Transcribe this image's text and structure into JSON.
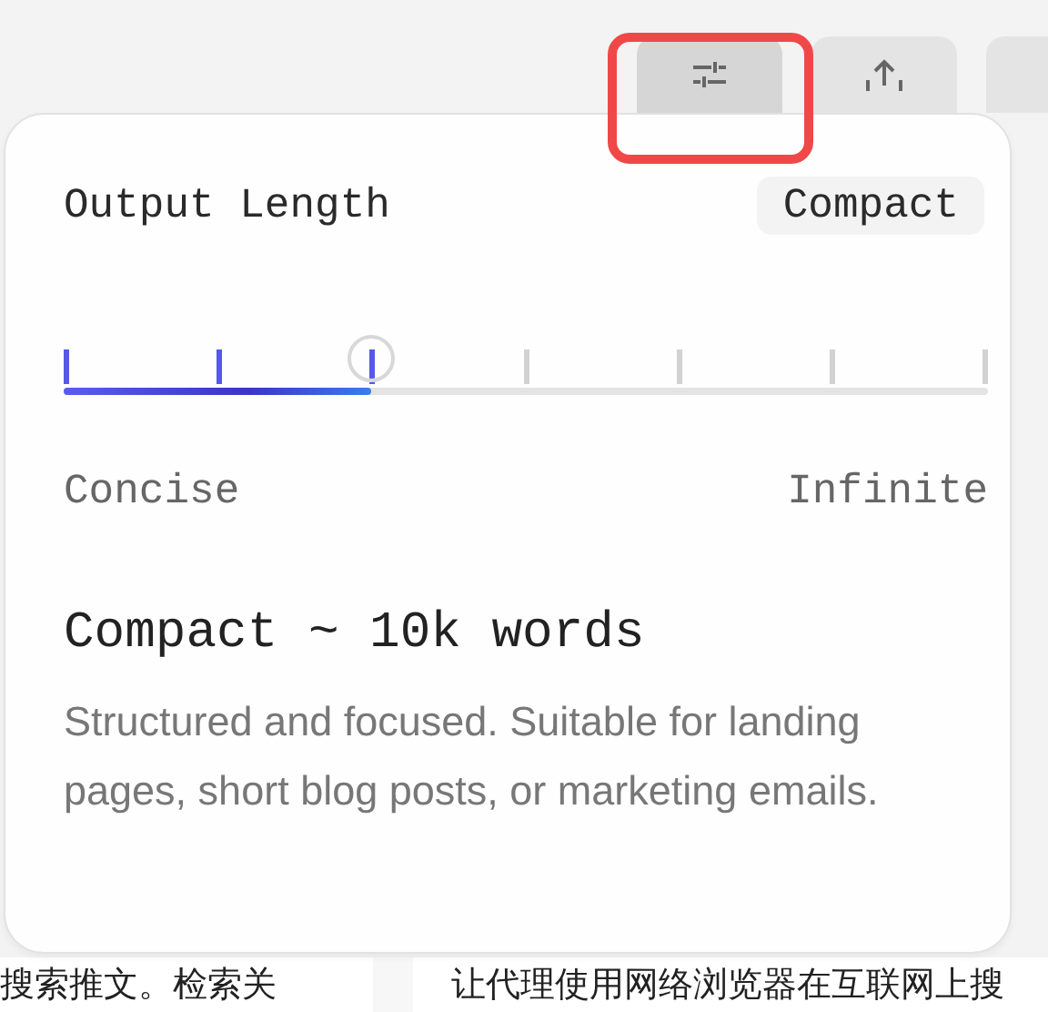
{
  "toolbar": [
    {
      "kind": "sliders",
      "selected": true,
      "highlighted": true
    },
    {
      "kind": "upload",
      "selected": false,
      "highlighted": false
    },
    {
      "kind": "blank",
      "selected": false,
      "highlighted": false
    }
  ],
  "popover": {
    "title": "Output Length",
    "badge": "Compact",
    "slider": {
      "level": 0.333,
      "min_label": "Concise",
      "max_label": "Infinite"
    },
    "preset": {
      "name": "Compact",
      "detail": "~ 10k words",
      "description": "Structured and focused. Suitable for landing pages, short blog posts, or marketing emails."
    }
  },
  "cards": [
    {
      "text": "搜索推文。检索关"
    },
    {
      "text": "让代理使用网络浏览器在互联网上搜"
    }
  ]
}
